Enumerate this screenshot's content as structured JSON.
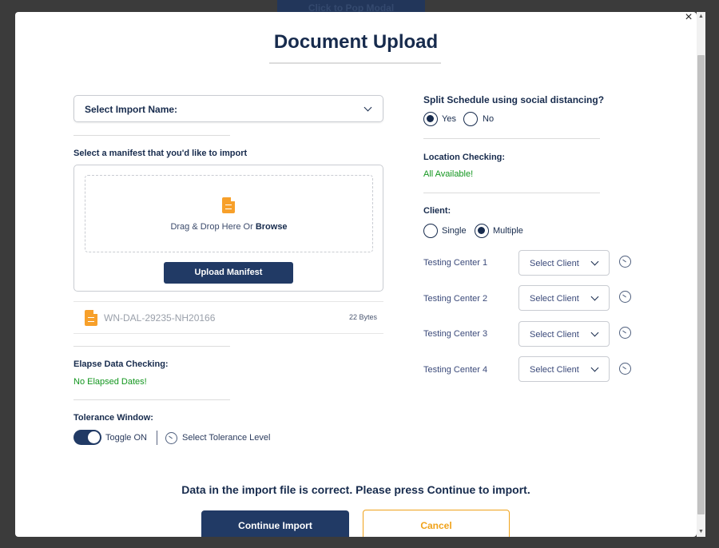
{
  "background": {
    "button_label": "Click to Pop Modal"
  },
  "modal": {
    "title": "Document Upload",
    "close_glyph": "×"
  },
  "import": {
    "select_label": "Select Import Name:",
    "manifest_prompt": "Select a manifest that you'd like to import",
    "drop_text_prefix": "Drag & Drop Here Or ",
    "drop_text_link": "Browse",
    "upload_button": "Upload Manifest",
    "file": {
      "name": "WN-DAL-29235-NH20166",
      "size": "22 Bytes"
    }
  },
  "elapse": {
    "label": "Elapse Data Checking:",
    "status": "No Elapsed Dates!"
  },
  "tolerance": {
    "label": "Tolerance Window:",
    "toggle_label": "Toggle ON",
    "toggle_on": true,
    "level_label": "Select Tolerance Level"
  },
  "split": {
    "question": "Split Schedule using social distancing?",
    "options": [
      {
        "label": "Yes",
        "selected": true
      },
      {
        "label": "No",
        "selected": false
      }
    ]
  },
  "location": {
    "label": "Location Checking:",
    "status": "All Available!"
  },
  "client": {
    "label": "Client:",
    "options": [
      {
        "label": "Single",
        "selected": false
      },
      {
        "label": "Multiple",
        "selected": true
      }
    ],
    "testing_centers": [
      {
        "label": "Testing Center 1",
        "select": "Select Client"
      },
      {
        "label": "Testing Center 2",
        "select": "Select Client"
      },
      {
        "label": "Testing Center 3",
        "select": "Select Client"
      },
      {
        "label": "Testing Center 4",
        "select": "Select Client"
      }
    ]
  },
  "footer": {
    "message": "Data in the import file is correct. Please press Continue to import.",
    "continue_button": "Continue Import",
    "cancel_button": "Cancel"
  },
  "colors": {
    "navy": "#172b4d",
    "button_navy": "#213a65",
    "success_green": "#12961e",
    "cancel_orange": "#f0a21a",
    "file_icon_orange": "#f7a02a"
  }
}
